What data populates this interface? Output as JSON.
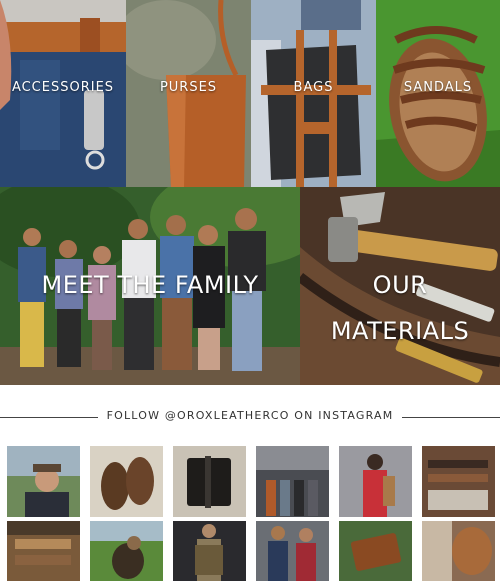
{
  "categories": [
    {
      "label": "ACCESSORIES"
    },
    {
      "label": "PURSES"
    },
    {
      "label": "BAGS"
    },
    {
      "label": "SANDALS"
    }
  ],
  "features": {
    "family_label": "MEET THE FAMILY",
    "materials_line1": "OUR",
    "materials_line2": "MATERIALS"
  },
  "instagram": {
    "follow_text": "FOLLOW @OROXLEATHERCO ON INSTAGRAM"
  },
  "colors": {
    "leather": "#b5652c",
    "text_dark": "#333333",
    "overlay_text": "#ffffff"
  }
}
